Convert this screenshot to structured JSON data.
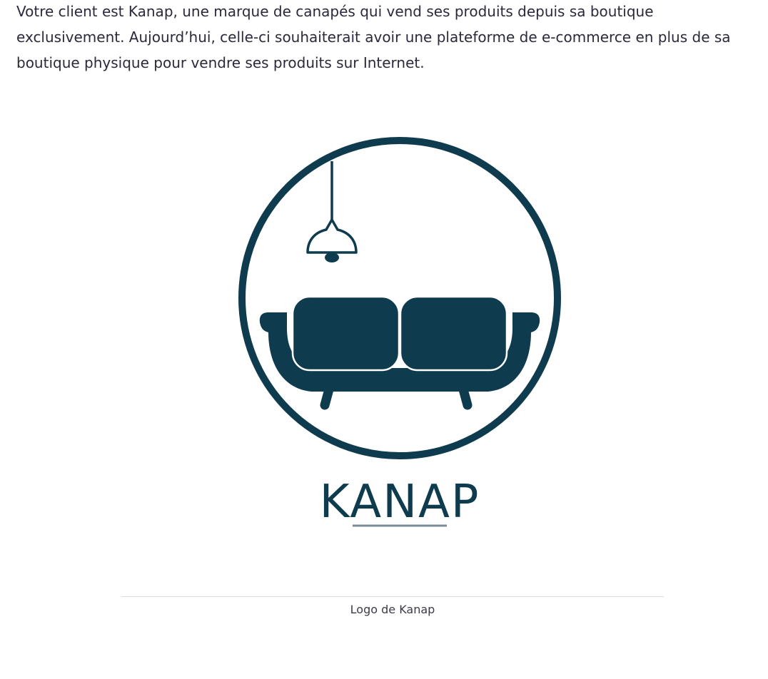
{
  "article": {
    "intro_text": "Votre client est Kanap, une marque de canapés qui vend ses produits depuis sa boutique exclusivement. Aujourd’hui, celle-ci souhaiterait avoir une plateforme de e-commerce en plus de sa boutique physique pour vendre ses produits sur Internet."
  },
  "figure": {
    "logo_text": "KANAP",
    "caption": "Logo de Kanap"
  },
  "colors": {
    "brand": "#0e3b4d",
    "underline": "#7c8a99",
    "divider": "#d9d9de"
  }
}
